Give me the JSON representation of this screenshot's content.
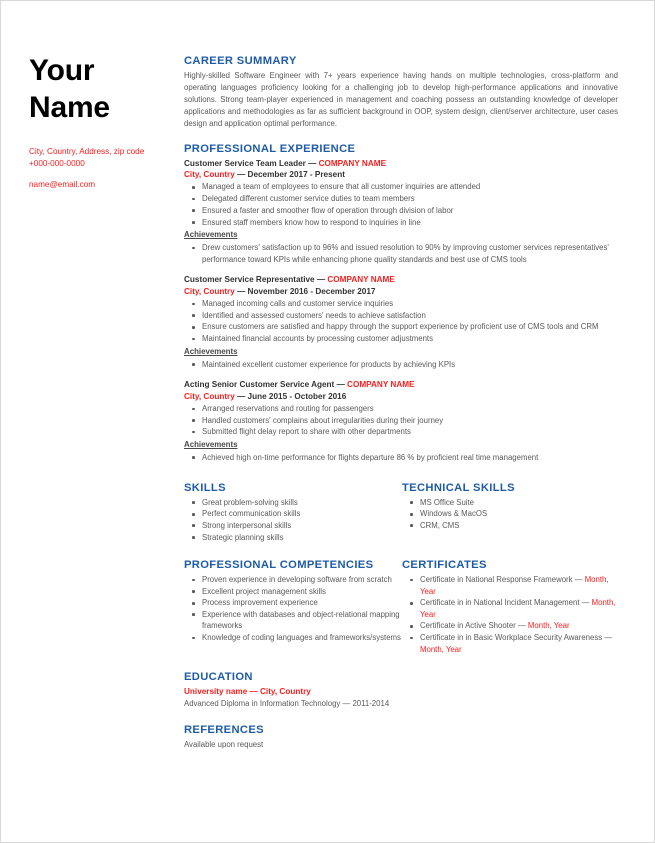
{
  "header": {
    "name_line1": "Your",
    "name_line2": "Name",
    "address": "City, Country, Address, zip code",
    "phone": "+000-000-0000",
    "email": "name@email.com"
  },
  "colors": {
    "heading_blue": "#1f5ca8",
    "accent_red": "#fb2020",
    "body_gray": "#5a5a5a",
    "name_black": "#000000"
  },
  "career_summary": {
    "heading": "CAREER SUMMARY",
    "text": "Highly-skilled Software Engineer with 7+ years experience having hands on multiple technologies, cross-platform and operating languages proficiency looking for a challenging job to  develop high-performance applications and innovative solutions. Strong team-player experienced in management and coaching possess an outstanding knowledge of  developer applications and methodologies as far as sufficient background in OOP, system design, client/server architecture, user cases design and application optimal performance."
  },
  "professional_experience": {
    "heading": "PROFESSIONAL EXPERIENCE",
    "achievements_label": "Achievements",
    "jobs": [
      {
        "title": "Customer Service Team Leader",
        "separator": " — ",
        "company": "COMPANY NAME",
        "location": "City, Country",
        "dates": " — December 2017 - Present",
        "bullets": [
          "Managed a team of employees to ensure that all customer inquiries are attended",
          "Delegated different customer service duties to team members",
          "Ensured a faster and smoother flow of operation through division of labor",
          "Ensured staff members know how to respond to inquiries in line"
        ],
        "achievements": [
          "Drew customers' satisfaction up to 96% and issued resolution to 90% by improving customer services representatives' performance toward KPIs while enhancing phone quality standards and best use of CMS tools"
        ]
      },
      {
        "title": "Customer Service Representative ",
        "separator": " — ",
        "company": "COMPANY NAME",
        "location": "City, Country",
        "dates": " — November 2016 - December 2017",
        "bullets": [
          "Managed incoming calls and customer service inquiries",
          "Identified and assessed customers' needs to achieve satisfaction",
          "Ensure customers are satisfied and happy through the support experience by proficient use of CMS tools and CRM",
          "Maintained financial accounts by processing customer adjustments"
        ],
        "achievements": [
          "Maintained excellent customer experience for products by achieving KPIs"
        ]
      },
      {
        "title": "Acting Senior Customer Service Agent ",
        "separator": " — ",
        "company": "COMPANY NAME",
        "location": "City, Country",
        "dates": " — June 2015 - October 2016",
        "bullets": [
          "Arranged reservations and routing for passengers",
          "Handled customers' complains about irregularities during their journey",
          "Submitted flight delay report to share with other departments"
        ],
        "achievements": [
          "Achieved high on-time performance for flights departure 86 % by proficient real time management"
        ]
      }
    ]
  },
  "skills": {
    "heading": "SKILLS",
    "items": [
      "Great problem-solving skills",
      "Perfect communication skills",
      "Strong interpersonal skills",
      "Strategic planning skills"
    ]
  },
  "technical_skills": {
    "heading": "TECHNICAL SKILLS",
    "items": [
      "MS Office Suite",
      "Windows & MacOS",
      "CRM, CMS"
    ]
  },
  "professional_competencies": {
    "heading": "PROFESSIONAL COMPETENCIES",
    "items": [
      "Proven experience in developing software from scratch",
      "Excellent project management skills",
      "Process improvement experience",
      "Experience with databases and object-relational mapping frameworks",
      "Knowledge of coding languages and frameworks/systems"
    ]
  },
  "certificates": {
    "heading": "CERTIFICATES",
    "items": [
      {
        "name": "Certificate in National Response Framework",
        "separator": " — ",
        "date": "Month, Year"
      },
      {
        "name": "Certificate in in National Incident Management",
        "separator": " — ",
        "date": "Month, Year"
      },
      {
        "name": "Certificate in Active Shooter",
        "separator": " — ",
        "date": "Month, Year"
      },
      {
        "name": "Certificate in in Basic Workplace Security Awareness",
        "separator": " — ",
        "date": "Month, Year"
      }
    ]
  },
  "education": {
    "heading": "EDUCATION",
    "university": "University name",
    "separator": " — ",
    "location": "City, Country",
    "degree": "Advanced Diploma in Information Technology — 2011-2014"
  },
  "references": {
    "heading": "REFERENCES",
    "text": "Available upon request"
  }
}
